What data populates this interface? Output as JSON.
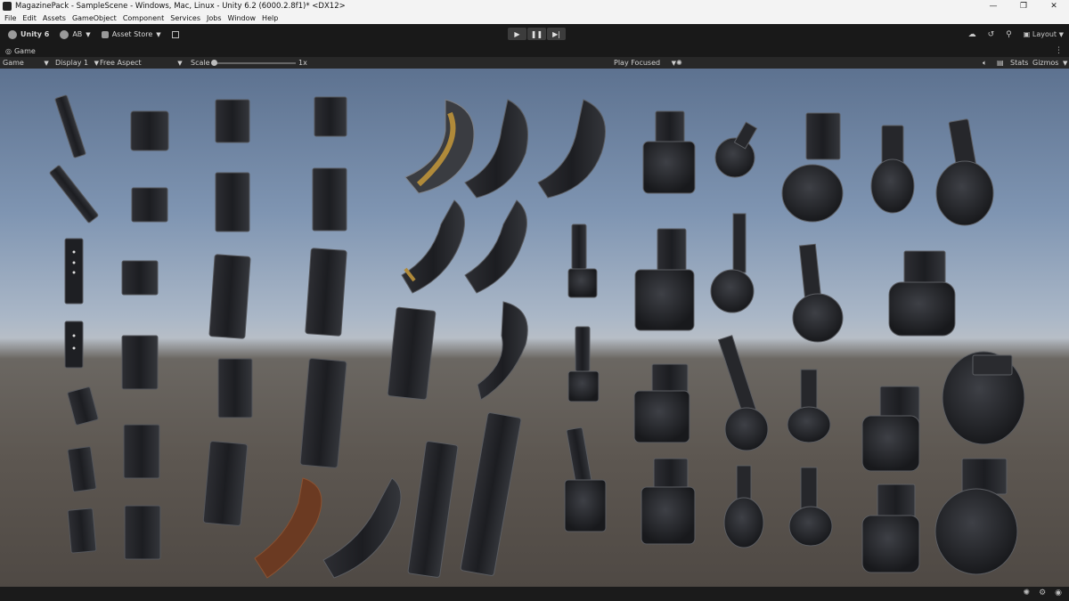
{
  "window": {
    "title": "MagazinePack - SampleScene - Windows, Mac, Linux - Unity 6.2 (6000.2.8f1)* <DX12>",
    "controls": [
      "—",
      "❐",
      "✕"
    ]
  },
  "menu": [
    "File",
    "Edit",
    "Assets",
    "GameObject",
    "Component",
    "Services",
    "Jobs",
    "Window",
    "Help"
  ],
  "toolbar": {
    "unity_label": "Unity 6",
    "account_label": "AB",
    "asset_store_label": "Asset Store",
    "play_icon": "▶",
    "pause_icon": "❚❚",
    "step_icon": "▶|",
    "layout_label": "Layout"
  },
  "tab": {
    "name": "Game"
  },
  "gamebar": {
    "mode": "Game",
    "display": "Display 1",
    "aspect": "Free Aspect",
    "scale_label": "Scale",
    "scale_value": "1x",
    "play_focused": "Play Focused",
    "stats": "Stats",
    "gizmos": "Gizmos"
  },
  "colors": {
    "toolbar_bg": "#191919",
    "sky_top": "#5d7290",
    "horizon": "#b7bec7",
    "ground": "#5d5751",
    "magazine_dark": "#26272b",
    "magazine_rim": "#56585d",
    "brass": "#b08a3a",
    "rust": "#6b3a22"
  }
}
